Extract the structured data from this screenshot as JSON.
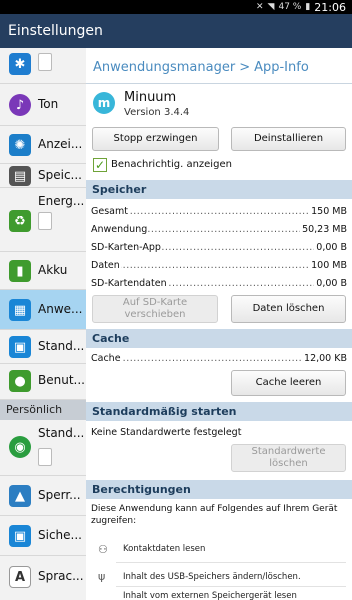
{
  "statusbar": {
    "battery": "47 %",
    "time": "21:06"
  },
  "titlebar": {
    "title": "Einstellungen"
  },
  "sidebar": {
    "items": [
      {
        "label": "",
        "icon": "bluetooth-icon",
        "color": "#1f7dd0",
        "glyph": "✱"
      },
      {
        "label": "Ton",
        "icon": "sound-icon",
        "color": "#7a38b8",
        "glyph": "♪"
      },
      {
        "label": "Anzei...",
        "icon": "display-icon",
        "color": "#1c7ec9",
        "glyph": "✺"
      },
      {
        "label": "Speic...",
        "icon": "storage-icon",
        "color": "#555555",
        "glyph": "▤"
      },
      {
        "label": "Energ...",
        "icon": "power-saving-icon",
        "color": "#3f9b2e",
        "glyph": "♻"
      },
      {
        "label": "Akku",
        "icon": "battery-icon",
        "color": "#3f9b2e",
        "glyph": "▮"
      },
      {
        "label": "Anwe...",
        "icon": "apps-icon",
        "color": "#1a86d6",
        "glyph": "▦"
      },
      {
        "label": "Stand...",
        "icon": "default-apps-icon",
        "color": "#1a86d6",
        "glyph": "▣"
      },
      {
        "label": "Benut...",
        "icon": "user-icon",
        "color": "#3f9b2e",
        "glyph": "●"
      },
      {
        "label": "Stand...",
        "icon": "location-icon",
        "color": "#2a9d3f",
        "glyph": "◉"
      },
      {
        "label": "Sperr...",
        "icon": "lockscreen-icon",
        "color": "#2c7ec2",
        "glyph": "▲"
      },
      {
        "label": "Siche...",
        "icon": "security-icon",
        "color": "#1a86d6",
        "glyph": "🔒"
      },
      {
        "label": "Sprac...",
        "icon": "language-icon",
        "color": "#555555",
        "glyph": "A"
      }
    ],
    "section_personal": "Persönlich"
  },
  "main": {
    "breadcrumb_parent": "Anwendungsmanager",
    "breadcrumb_sep": ">",
    "breadcrumb_current": "App-Info",
    "app_name": "Minuum",
    "app_version": "Version 3.4.4",
    "app_icon_letter": "m",
    "force_stop_label": "Stopp erzwingen",
    "uninstall_label": "Deinstallieren",
    "notifications_label": "Benachrichtig. anzeigen",
    "notifications_checked": true,
    "storage": {
      "header": "Speicher",
      "rows": [
        {
          "label": "Gesamt",
          "value": "150 MB"
        },
        {
          "label": "Anwendung",
          "value": "50,23 MB"
        },
        {
          "label": "SD-Karten-App",
          "value": "0,00 B"
        },
        {
          "label": "Daten",
          "value": "100 MB"
        },
        {
          "label": "SD-Kartendaten",
          "value": "0,00 B"
        }
      ],
      "move_to_sd_label": "Auf SD-Karte verschieben",
      "clear_data_label": "Daten löschen"
    },
    "cache": {
      "header": "Cache",
      "label": "Cache",
      "value": "12,00 KB",
      "clear_cache_label": "Cache leeren"
    },
    "defaults": {
      "header": "Standardmäßig starten",
      "none_text": "Keine Standardwerte festgelegt",
      "clear_defaults_label": "Standardwerte löschen"
    },
    "permissions": {
      "header": "Berechtigungen",
      "intro": "Diese Anwendung kann auf Folgendes auf Ihrem Gerät zugreifen:",
      "items": [
        {
          "icon": "contacts-icon",
          "text": "Kontaktdaten lesen"
        },
        {
          "icon": "usb-icon",
          "text": "Inhalt des USB-Speichers ändern/löschen."
        },
        {
          "icon": "usb-icon",
          "text": "Inhalt vom externen Speichergerät lesen"
        }
      ]
    }
  }
}
